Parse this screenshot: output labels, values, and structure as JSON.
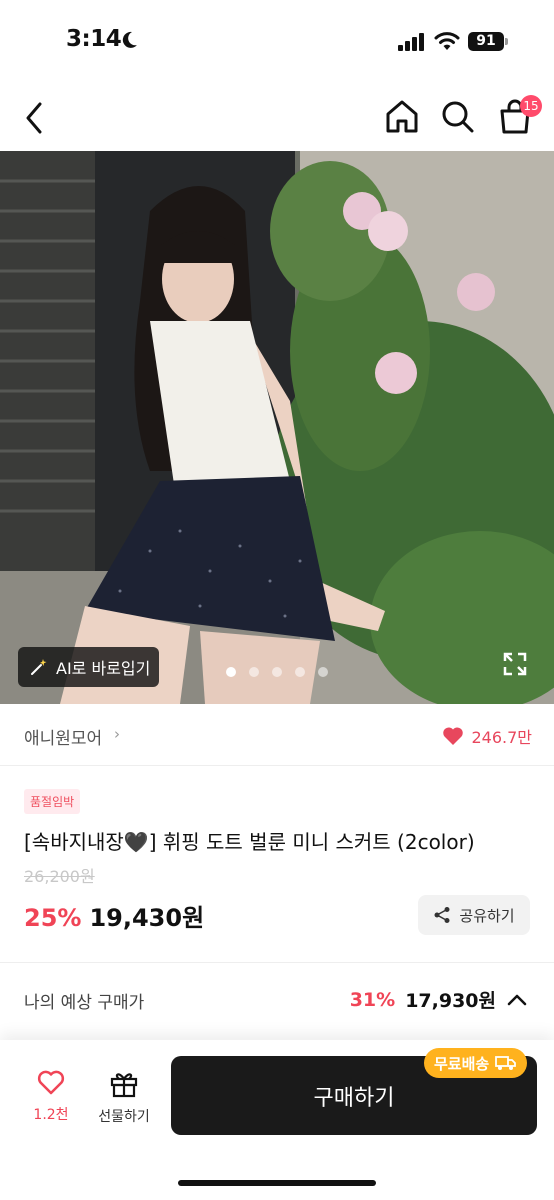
{
  "status_bar": {
    "time": "3:14",
    "battery": "91"
  },
  "nav": {
    "cart_count": "15"
  },
  "hero": {
    "ai_button_label": "AI로 바로입기",
    "slide_count": 5,
    "active_slide": 1
  },
  "brand": {
    "name": "애니원모어",
    "likes": "246.7만"
  },
  "product": {
    "tag": "품절임박",
    "title": "[속바지내장🖤] 휘핑 도트 벌룬 미니 스커트 (2color)",
    "original_price": "26,200원",
    "discount": "25%",
    "price": "19,430원",
    "share_label": "공유하기"
  },
  "expected": {
    "label": "나의 예상 구매가",
    "discount": "31%",
    "price": "17,930원"
  },
  "bottom": {
    "wish_count": "1.2천",
    "gift_label": "선물하기",
    "buy_label": "구매하기",
    "free_shipping": "무료배송"
  },
  "colors": {
    "accent": "#f04456",
    "badge": "#ff4b6b",
    "shipping": "#ffb21e",
    "buy_button": "#1a1a1a"
  }
}
